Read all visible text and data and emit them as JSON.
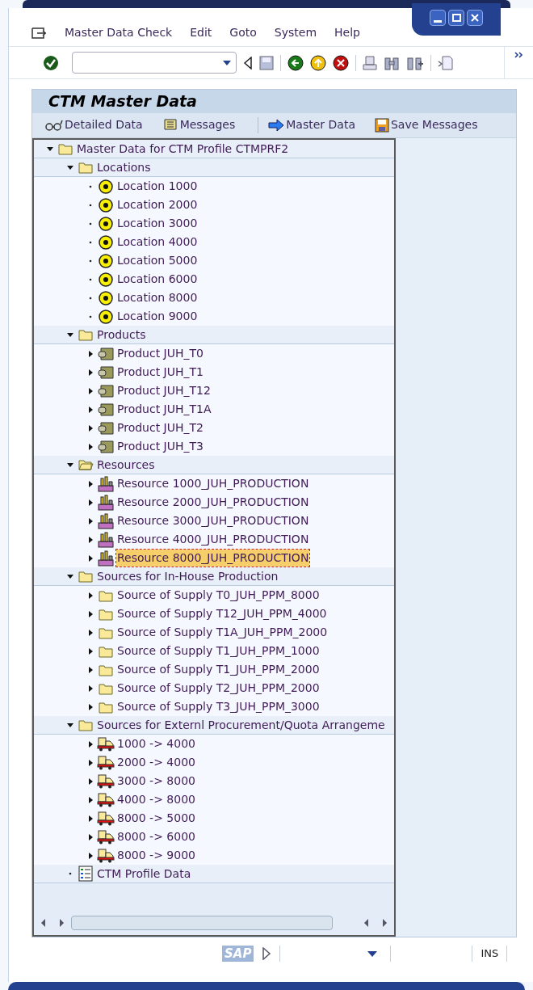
{
  "menu": [
    {
      "label": "Master Data Check"
    },
    {
      "label": "Edit"
    },
    {
      "label": "Goto"
    },
    {
      "label": "System"
    },
    {
      "label": "Help"
    }
  ],
  "title": "CTM Master Data",
  "app_toolbar": [
    {
      "label": "Detailed Data",
      "kind": "glasses"
    },
    {
      "label": "Messages",
      "kind": "scroll"
    },
    {
      "label": "Master Data",
      "kind": "arrow"
    },
    {
      "label": "Save Messages",
      "kind": "save"
    }
  ],
  "tree": [
    {
      "label": "Master Data for CTM Profile CTMPRF2",
      "kind": "folder",
      "expanded": true,
      "selected": false,
      "children": [
        {
          "label": "Locations",
          "kind": "folder",
          "expanded": true,
          "selected": false,
          "children": [
            {
              "label": "Location 1000",
              "kind": "location",
              "selected": false
            },
            {
              "label": "Location 2000",
              "kind": "location",
              "selected": false
            },
            {
              "label": "Location 3000",
              "kind": "location",
              "selected": false
            },
            {
              "label": "Location 4000",
              "kind": "location",
              "selected": false
            },
            {
              "label": "Location 5000",
              "kind": "location",
              "selected": false
            },
            {
              "label": "Location 6000",
              "kind": "location",
              "selected": false
            },
            {
              "label": "Location 8000",
              "kind": "location",
              "selected": false
            },
            {
              "label": "Location 9000",
              "kind": "location",
              "selected": false
            }
          ]
        },
        {
          "label": "Products",
          "kind": "folder",
          "expanded": true,
          "selected": false,
          "children": [
            {
              "label": "Product JUH_T0",
              "kind": "product",
              "expanded": false,
              "selected": false
            },
            {
              "label": "Product JUH_T1",
              "kind": "product",
              "expanded": false,
              "selected": false
            },
            {
              "label": "Product JUH_T12",
              "kind": "product",
              "expanded": false,
              "selected": false
            },
            {
              "label": "Product JUH_T1A",
              "kind": "product",
              "expanded": false,
              "selected": false
            },
            {
              "label": "Product JUH_T2",
              "kind": "product",
              "expanded": false,
              "selected": false
            },
            {
              "label": "Product JUH_T3",
              "kind": "product",
              "expanded": false,
              "selected": false
            }
          ]
        },
        {
          "label": "Resources",
          "kind": "open-folder",
          "expanded": true,
          "selected": false,
          "children": [
            {
              "label": "Resource 1000_JUH_PRODUCTION",
              "kind": "resource",
              "expanded": false,
              "selected": false
            },
            {
              "label": "Resource 2000_JUH_PRODUCTION",
              "kind": "resource",
              "expanded": false,
              "selected": false
            },
            {
              "label": "Resource 3000_JUH_PRODUCTION",
              "kind": "resource",
              "expanded": false,
              "selected": false
            },
            {
              "label": "Resource 4000_JUH_PRODUCTION",
              "kind": "resource",
              "expanded": false,
              "selected": false
            },
            {
              "label": "Resource 8000_JUH_PRODUCTION",
              "kind": "resource",
              "expanded": false,
              "selected": true
            }
          ]
        },
        {
          "label": "Sources for In-House Production",
          "kind": "folder",
          "expanded": true,
          "selected": false,
          "children": [
            {
              "label": "Source of Supply T0_JUH_PPM_8000",
              "kind": "folder",
              "expanded": false,
              "selected": false
            },
            {
              "label": "Source of Supply T12_JUH_PPM_4000",
              "kind": "folder",
              "expanded": false,
              "selected": false
            },
            {
              "label": "Source of Supply T1A_JUH_PPM_2000",
              "kind": "folder",
              "expanded": false,
              "selected": false
            },
            {
              "label": "Source of Supply T1_JUH_PPM_1000",
              "kind": "folder",
              "expanded": false,
              "selected": false
            },
            {
              "label": "Source of Supply T1_JUH_PPM_2000",
              "kind": "folder",
              "expanded": false,
              "selected": false
            },
            {
              "label": "Source of Supply T2_JUH_PPM_2000",
              "kind": "folder",
              "expanded": false,
              "selected": false
            },
            {
              "label": "Source of Supply T3_JUH_PPM_3000",
              "kind": "folder",
              "expanded": false,
              "selected": false
            }
          ]
        },
        {
          "label": "Sources for Externl Procurement/Quota Arrangeme",
          "kind": "folder",
          "expanded": true,
          "selected": false,
          "children": [
            {
              "label": "1000 -> 4000",
              "kind": "truck",
              "expanded": false,
              "selected": false
            },
            {
              "label": "2000 -> 4000",
              "kind": "truck",
              "expanded": false,
              "selected": false
            },
            {
              "label": "3000 -> 8000",
              "kind": "truck",
              "expanded": false,
              "selected": false
            },
            {
              "label": "4000 -> 8000",
              "kind": "truck",
              "expanded": false,
              "selected": false
            },
            {
              "label": "8000 -> 5000",
              "kind": "truck",
              "expanded": false,
              "selected": false
            },
            {
              "label": "8000 -> 6000",
              "kind": "truck",
              "expanded": false,
              "selected": false
            },
            {
              "label": "8000 -> 9000",
              "kind": "truck",
              "expanded": false,
              "selected": false
            }
          ]
        },
        {
          "label": "CTM Profile Data",
          "kind": "profile",
          "selected": false
        }
      ]
    }
  ],
  "status_bar": {
    "logo": "SAP",
    "mode": "INS"
  }
}
